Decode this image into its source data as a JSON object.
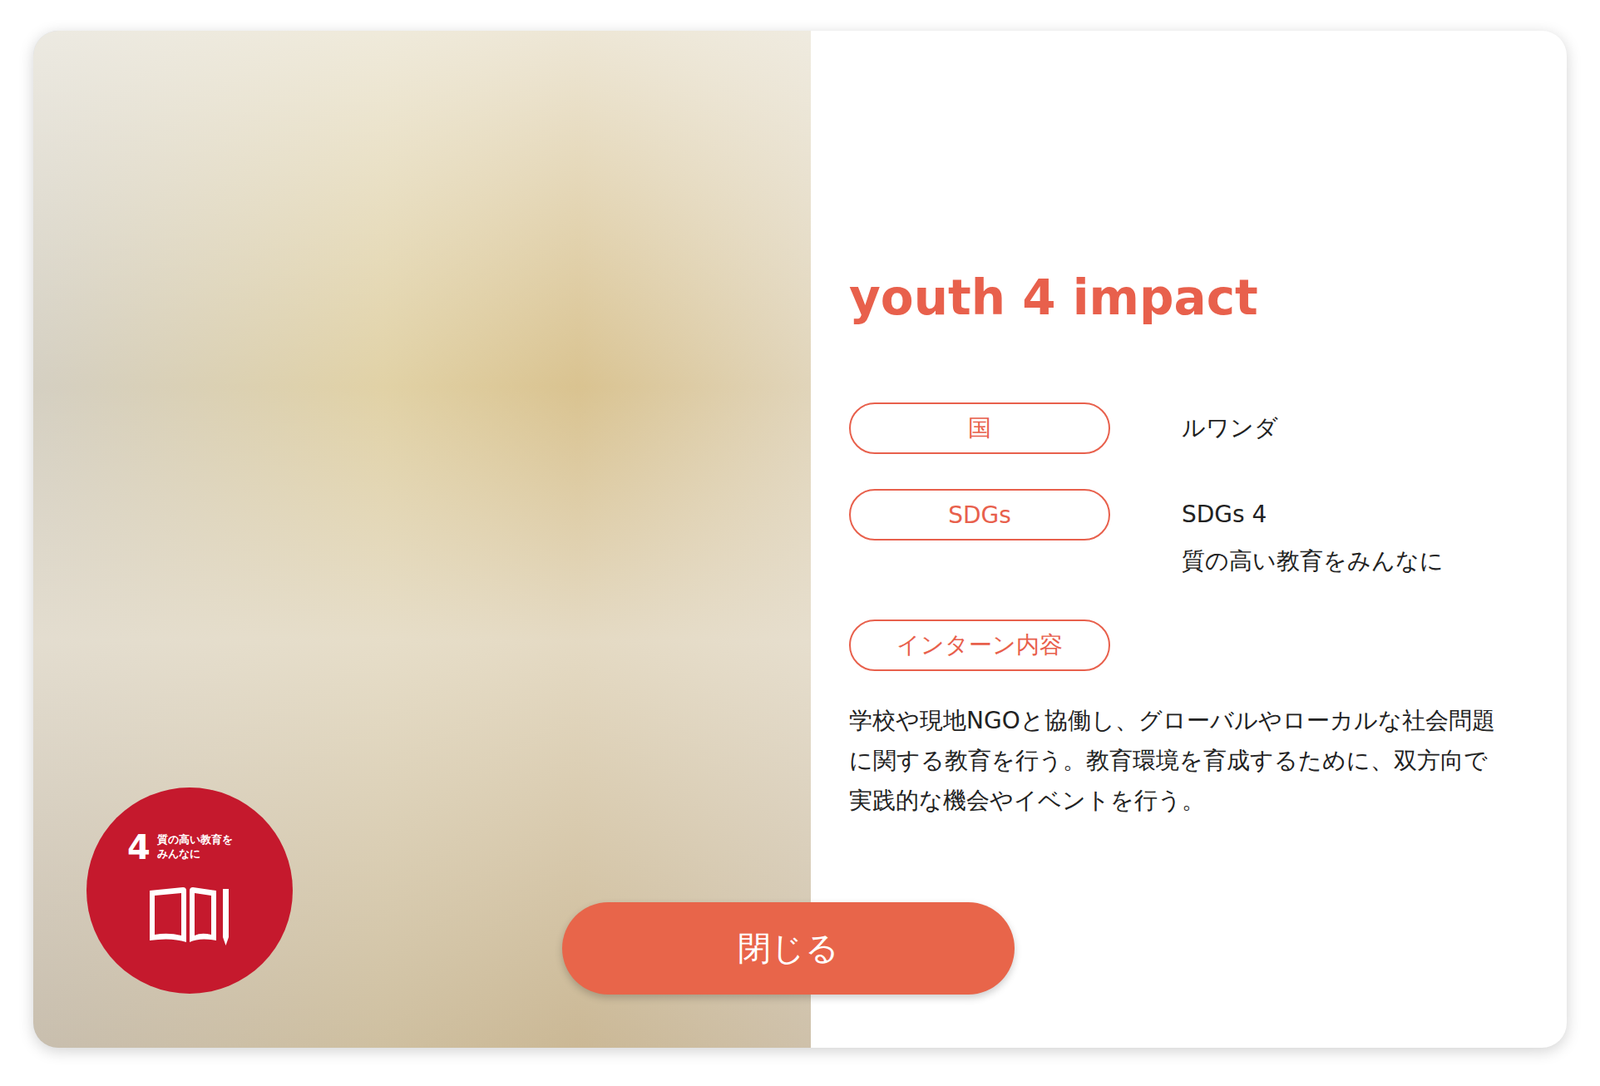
{
  "modal": {
    "title": "youth 4 impact",
    "badge": {
      "number": "4",
      "label_lines": [
        "質の高い教育を",
        "みんなに"
      ]
    },
    "rows": [
      {
        "label": "国",
        "values": [
          "ルワンダ"
        ]
      },
      {
        "label": "SDGs",
        "values": [
          "SDGs 4",
          "質の高い教育をみんなに"
        ]
      }
    ],
    "section": {
      "label": "インターン内容",
      "text": "学校や現地NGOと協働し、グローバルやローカルな社会問題に関する教育を行う。教育環境を育成するために、双方向で実践的な機会やイベントを行う。"
    },
    "close_button": "閉じる"
  }
}
